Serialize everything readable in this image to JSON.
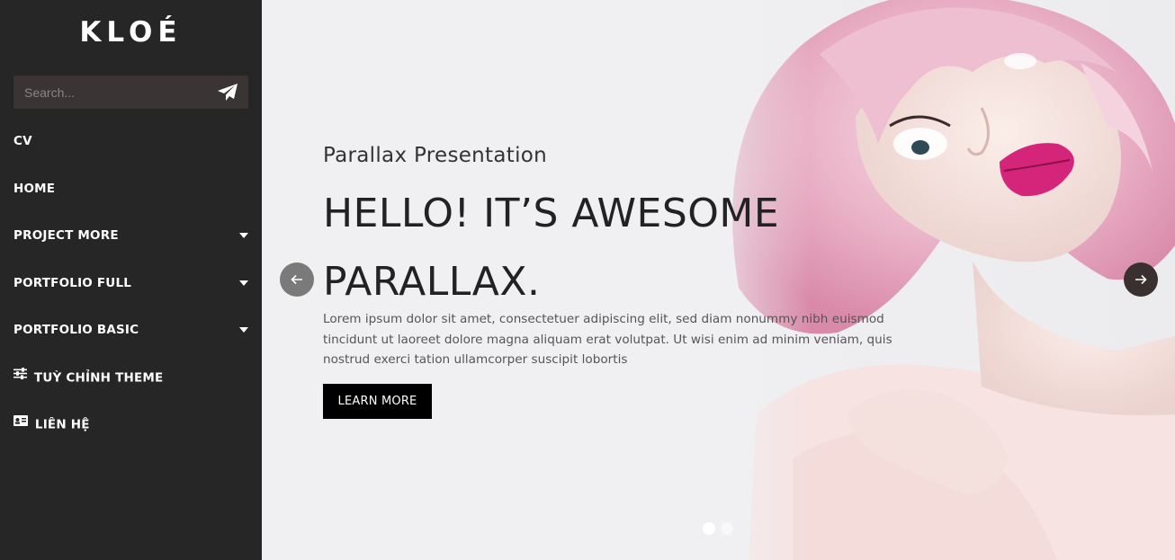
{
  "sidebar": {
    "logo": "KLOÉ",
    "search": {
      "placeholder": "Search...",
      "value": ""
    },
    "items": [
      {
        "label": "CV",
        "has_dropdown": false
      },
      {
        "label": "HOME",
        "has_dropdown": false
      },
      {
        "label": "PROJECT MORE",
        "has_dropdown": true
      },
      {
        "label": "PORTFOLIO FULL",
        "has_dropdown": true
      },
      {
        "label": "PORTFOLIO BASIC",
        "has_dropdown": true
      },
      {
        "label": "TUỲ CHỈNH THEME",
        "icon": "sliders-icon"
      },
      {
        "label": "LIÊN HỆ",
        "icon": "contact-card-icon"
      }
    ]
  },
  "hero": {
    "subtitle": "Parallax Presentation",
    "headline": "HELLO! IT’S AWESOME PARALLAX.",
    "body": "Lorem ipsum dolor sit amet, consectetuer adipiscing elit, sed diam nonummy nibh euismod tincidunt ut laoreet dolore magna aliquam erat volutpat. Ut wisi enim ad minim veniam, quis nostrud exerci tation ullamcorper suscipit lobortis",
    "button_label": "LEARN MORE",
    "slides_total": 2,
    "active_slide": 1
  },
  "colors": {
    "sidebar_bg": "#262626",
    "search_bg": "#3a3434",
    "hero_bg": "#f0f0f2",
    "button_bg": "#000000",
    "accent_pink": "#e8a0b8"
  }
}
